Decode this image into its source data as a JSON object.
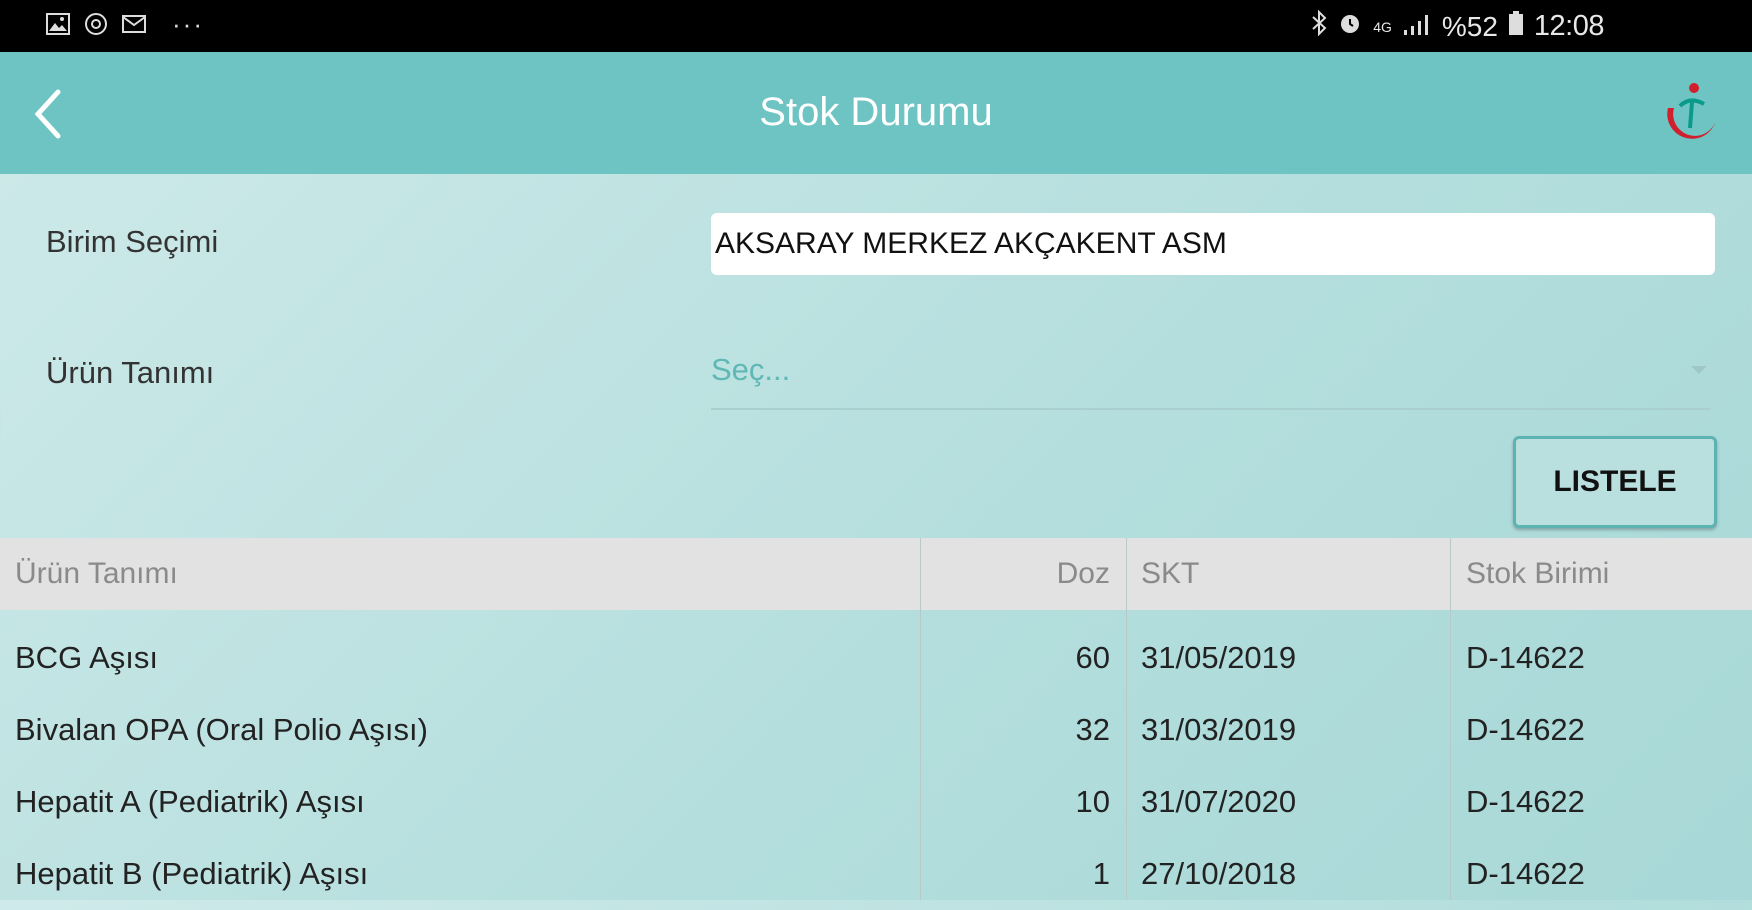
{
  "status_bar": {
    "icons_left": [
      "gallery-icon",
      "at-sign-icon",
      "mail-icon"
    ],
    "more": "···",
    "network": "4G",
    "battery": "%52",
    "time": "12:08"
  },
  "app_bar": {
    "title": "Stok Durumu"
  },
  "form": {
    "unit_label": "Birim Seçimi",
    "unit_value": "AKSARAY MERKEZ AKÇAKENT ASM",
    "product_label": "Ürün Tanımı",
    "product_placeholder": "Seç...",
    "list_button": "LISTELE"
  },
  "table": {
    "headers": [
      "Ürün Tanımı",
      "Doz",
      "SKT",
      "Stok Birimi"
    ],
    "rows": [
      [
        "BCG Aşısı",
        "60",
        "31/05/2019",
        "D-14622"
      ],
      [
        "Bivalan OPA (Oral Polio Aşısı)",
        "32",
        "31/03/2019",
        "D-14622"
      ],
      [
        "Hepatit A (Pediatrik) Aşısı",
        "10",
        "31/07/2020",
        "D-14622"
      ],
      [
        "Hepatit B (Pediatrik) Aşısı",
        "1",
        "27/10/2018",
        "D-14622"
      ]
    ]
  },
  "colors": {
    "app_bar": "#6dc4c3",
    "accent": "#5fb7b6",
    "logo_red": "#d0202e"
  }
}
